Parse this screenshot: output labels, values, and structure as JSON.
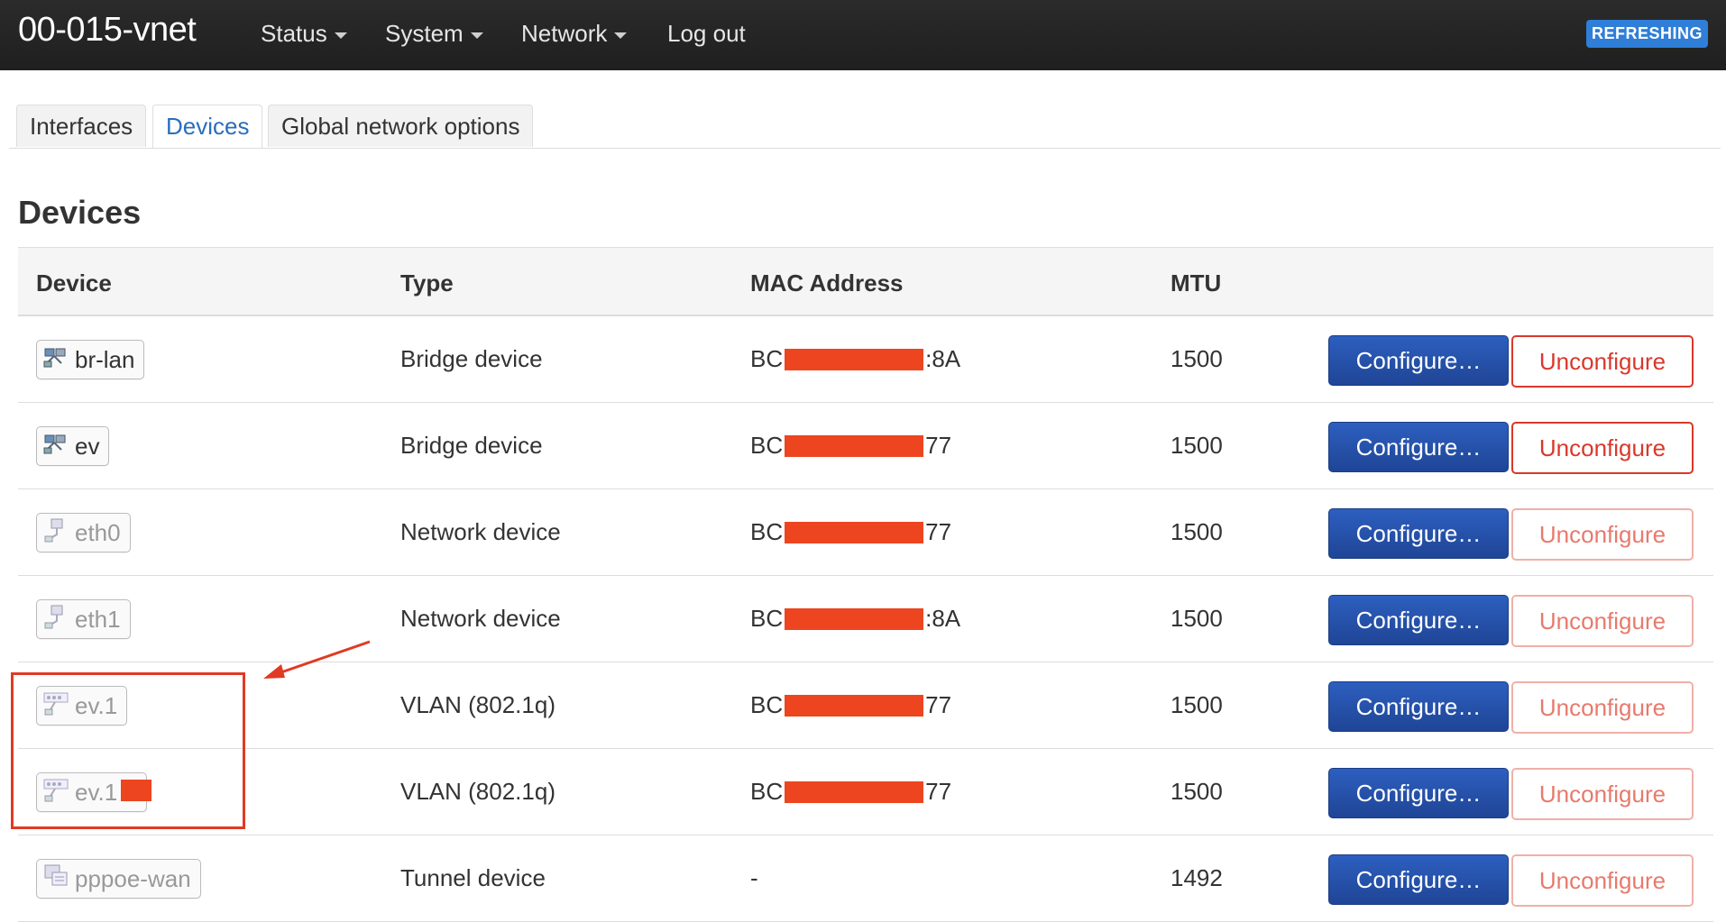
{
  "navbar": {
    "brand": "00-015-vnet",
    "menus": [
      {
        "label": "Status",
        "has_dropdown": true
      },
      {
        "label": "System",
        "has_dropdown": true
      },
      {
        "label": "Network",
        "has_dropdown": true
      },
      {
        "label": "Log out",
        "has_dropdown": false
      }
    ],
    "status_badge": "REFRESHING"
  },
  "tabs": [
    {
      "label": "Interfaces",
      "active": false
    },
    {
      "label": "Devices",
      "active": true
    },
    {
      "label": "Global network options",
      "active": false
    }
  ],
  "section_title": "Devices",
  "table": {
    "headers": {
      "device": "Device",
      "type": "Type",
      "mac": "MAC Address",
      "mtu": "MTU"
    },
    "rows": [
      {
        "device": "br-lan",
        "icon": "bridge-icon",
        "dim": false,
        "type": "Bridge device",
        "mac_prefix": "BC",
        "mac_suffix": ":8A",
        "mtu": "1500",
        "unconfigure_dim": false
      },
      {
        "device": "ev",
        "icon": "bridge-icon",
        "dim": false,
        "type": "Bridge device",
        "mac_prefix": "BC",
        "mac_suffix": "77",
        "mtu": "1500",
        "unconfigure_dim": false
      },
      {
        "device": "eth0",
        "icon": "ethernet-icon",
        "dim": true,
        "type": "Network device",
        "mac_prefix": "BC",
        "mac_suffix": "77",
        "mtu": "1500",
        "unconfigure_dim": true
      },
      {
        "device": "eth1",
        "icon": "ethernet-icon",
        "dim": true,
        "type": "Network device",
        "mac_prefix": "BC",
        "mac_suffix": ":8A",
        "mtu": "1500",
        "unconfigure_dim": true
      },
      {
        "device": "ev.1",
        "icon": "vlan-icon",
        "dim": true,
        "type": "VLAN (802.1q)",
        "mac_prefix": "BC",
        "mac_suffix": "77",
        "mtu": "1500",
        "unconfigure_dim": true
      },
      {
        "device": "ev.1 3",
        "icon": "vlan-icon",
        "dim": true,
        "type": "VLAN (802.1q)",
        "mac_prefix": "BC",
        "mac_suffix": "77",
        "mtu": "1500",
        "unconfigure_dim": true
      },
      {
        "device": "pppoe-wan",
        "icon": "tunnel-icon",
        "dim": true,
        "type": "Tunnel device",
        "mac_prefix": "-",
        "mac_suffix": "",
        "mtu": "1492",
        "unconfigure_dim": true
      }
    ]
  },
  "buttons": {
    "configure": "Configure…",
    "unconfigure": "Unconfigure"
  },
  "colors": {
    "navbar": "#222222",
    "configure": "#2451a8",
    "unconfigure": "#d9382a",
    "redaction": "#ec4520",
    "badge": "#2f7ed8"
  }
}
